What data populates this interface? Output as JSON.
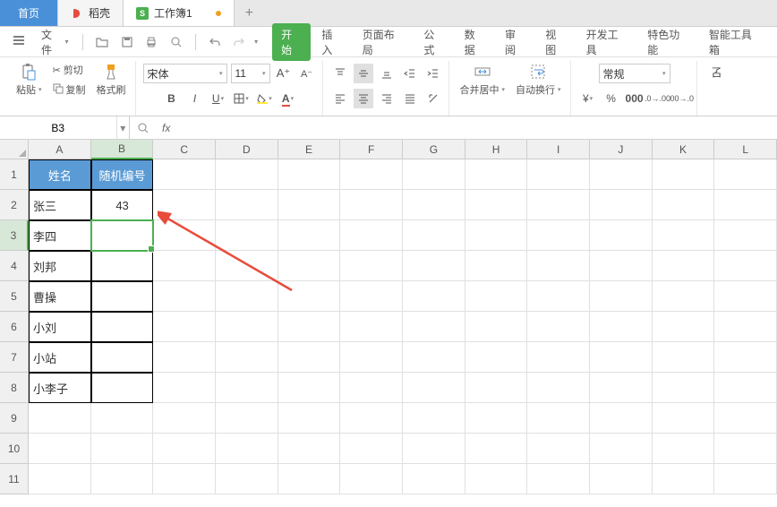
{
  "top_tabs": {
    "home": "首页",
    "doc1": "稻壳",
    "doc2": "工作簿1",
    "new": "+"
  },
  "file_menu": {
    "label": "文件"
  },
  "menu_tabs": [
    "开始",
    "插入",
    "页面布局",
    "公式",
    "数据",
    "审阅",
    "视图",
    "开发工具",
    "特色功能",
    "智能工具箱"
  ],
  "ribbon": {
    "paste": "粘贴",
    "cut": "剪切",
    "copy": "复制",
    "format_painter": "格式刷",
    "font_name": "宋体",
    "font_size": "11",
    "merge": "合并居中",
    "wrap": "自动换行",
    "number_format": "常规"
  },
  "name_box": "B3",
  "formula": "",
  "columns": [
    "A",
    "B",
    "C",
    "D",
    "E",
    "F",
    "G",
    "H",
    "I",
    "J",
    "K",
    "L"
  ],
  "rows": [
    "1",
    "2",
    "3",
    "4",
    "5",
    "6",
    "7",
    "8",
    "9",
    "10",
    "11"
  ],
  "table": {
    "header": {
      "a": "姓名",
      "b": "随机编号"
    },
    "rows": [
      {
        "a": "张三",
        "b": "43"
      },
      {
        "a": "李四",
        "b": ""
      },
      {
        "a": "刘邦",
        "b": ""
      },
      {
        "a": "曹操",
        "b": ""
      },
      {
        "a": "小刘",
        "b": ""
      },
      {
        "a": "小站",
        "b": ""
      },
      {
        "a": "小李子",
        "b": ""
      }
    ]
  },
  "active_cell": "B3",
  "selected_col": "B",
  "selected_row": "3"
}
